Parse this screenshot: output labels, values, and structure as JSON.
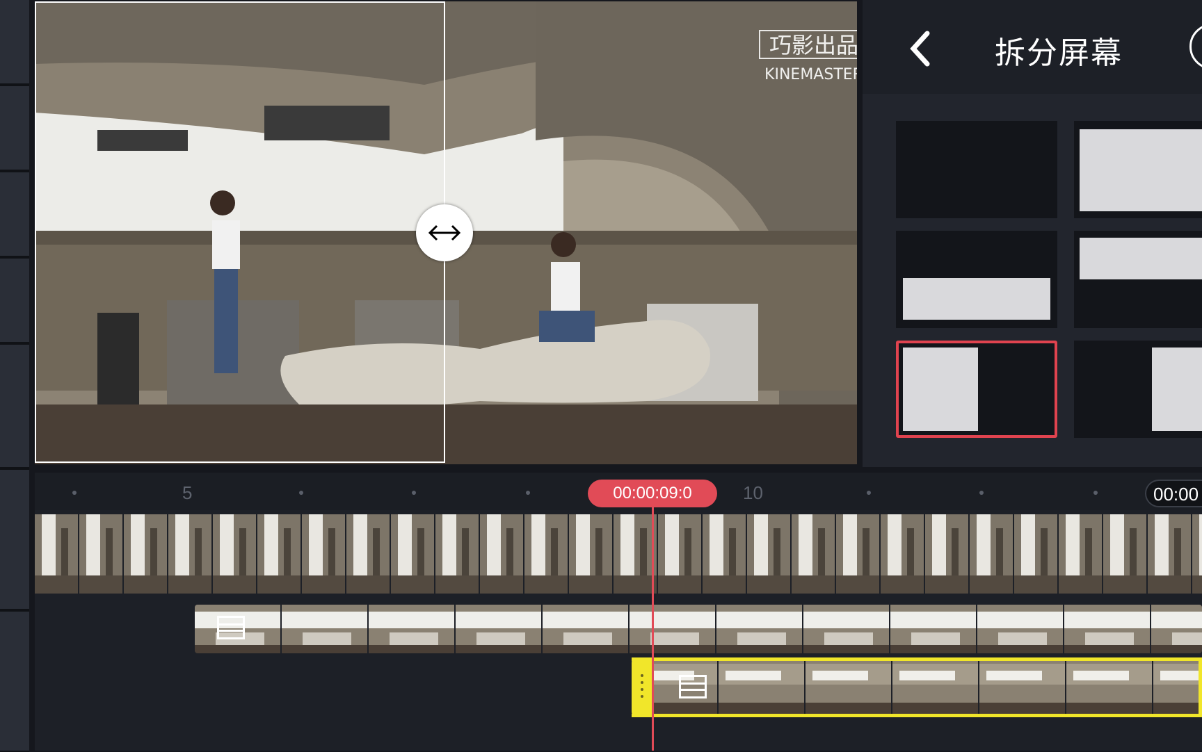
{
  "panel": {
    "title": "拆分屏幕",
    "back_label": "‹",
    "options": [
      {
        "id": "none",
        "label": ""
      },
      {
        "id": "full",
        "label": ""
      },
      {
        "id": "bottom-half",
        "label": ""
      },
      {
        "id": "top-half",
        "label": ""
      },
      {
        "id": "left-half",
        "label": "",
        "selected": true
      },
      {
        "id": "right-half",
        "label": ""
      }
    ]
  },
  "preview": {
    "watermark_top": "巧影出品",
    "watermark_bottom": "KINEMASTER",
    "handle_icon": "resize-horizontal-icon"
  },
  "timeline": {
    "current_time": "00:00:09:0",
    "end_time": "00:00",
    "ruler_labels": [
      "5",
      "10"
    ]
  },
  "colors": {
    "accent_red": "#e14b57",
    "selection_yellow": "#f1e62a"
  }
}
